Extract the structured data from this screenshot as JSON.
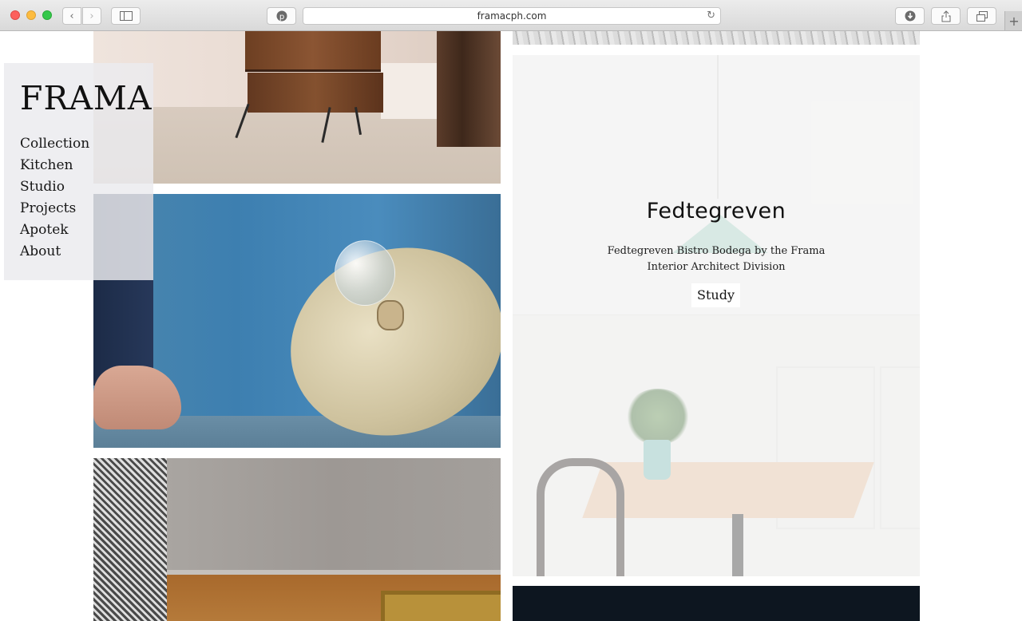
{
  "browser": {
    "url": "framacph.com",
    "back_icon": "chevron-left",
    "forward_icon": "chevron-right",
    "sidebar_icon": "sidebar",
    "extension_icon": "pinterest",
    "reload_icon": "reload",
    "download_icon": "download",
    "share_icon": "share",
    "tabs_icon": "tabs",
    "newtab_icon": "plus"
  },
  "site": {
    "logo": "FRAMA",
    "menu": [
      "Collection",
      "Kitchen",
      "Studio",
      "Projects",
      "Apotek",
      "About"
    ]
  },
  "featured": {
    "title": "Fedtegreven",
    "description": "Fedtegreven Bistro Bodega by the Frama Interior Architect Division",
    "link_label": "Study"
  }
}
